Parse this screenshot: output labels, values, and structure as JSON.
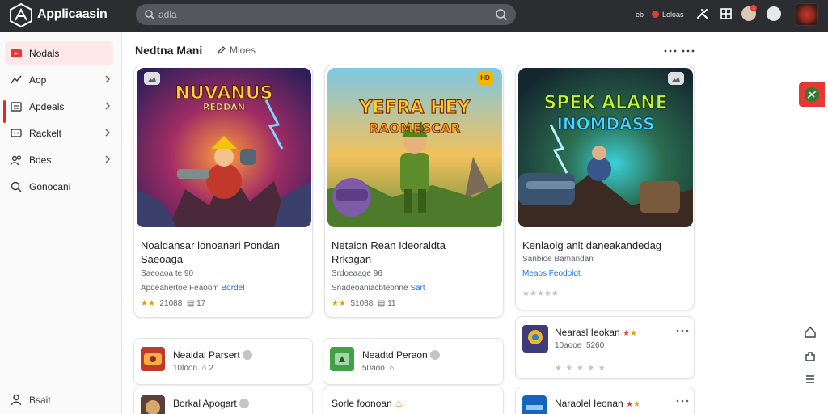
{
  "app": {
    "brand": "Applicaasin"
  },
  "search": {
    "placeholder": "adla"
  },
  "topbar": {
    "label_a": "eb",
    "label_b": "Loloas",
    "notif_count": "1"
  },
  "sidebar": {
    "items": [
      {
        "label": "Nodals",
        "icon": "youtube-icon"
      },
      {
        "label": "Aop",
        "icon": "trend-icon"
      },
      {
        "label": "Apdeals",
        "icon": "list-icon"
      },
      {
        "label": "Rackelt",
        "icon": "chat-icon"
      },
      {
        "label": "Bdes",
        "icon": "people-icon"
      },
      {
        "label": "Gonocani",
        "icon": "search-icon"
      }
    ],
    "bottom_label": "Bsait"
  },
  "section": {
    "title": "Nedtna Mani",
    "link": "Mioes"
  },
  "cards": [
    {
      "art_title": "NUVANUS",
      "art_subtitle": "REDDAN",
      "title_line1": "Noaldansar lonoanari Pondan",
      "title_line2": "Saeoaga",
      "meta": "Saeoaoa te 90",
      "link_prefix": "Apqeahertoe Feaoom",
      "link_text": "Bordel",
      "stats": "21088",
      "stats2": "17",
      "rating": 2
    },
    {
      "art_title": "YEFRA HEY",
      "art_subtitle": "RAOMESCAR",
      "title_line1": "Netaion Rean Ideoraldta",
      "title_line2": "Rrkagan",
      "meta": "Srdoeaage 96",
      "link_prefix": "Snadeoaniacbteonne",
      "link_text": "Sart",
      "stats": "51088",
      "stats2": "11",
      "rating": 2
    },
    {
      "art_title": "SPEK ALANE",
      "art_subtitle": "INOMDASS",
      "title_line1": "Kenlaolg anlt daneakandedag",
      "title_line2": "",
      "meta": "Sanbioe Bamandan",
      "link_prefix": "",
      "link_text": "Meaos Feodoldt",
      "stats": "",
      "stats2": "",
      "rating": 0
    }
  ],
  "small_cards": [
    {
      "title": "Nealdal Parsert",
      "meta": "10loon",
      "meta2": "2"
    },
    {
      "title": "Neadtd Peraon",
      "meta": "50aoo",
      "meta2": ""
    },
    {
      "title": "Nearasl Ieokan",
      "meta": "10aooe",
      "meta2": "5260"
    },
    {
      "title": "Borkal Apogart",
      "meta": "",
      "meta2": ""
    },
    {
      "title": "Sorle foonoan",
      "meta": "",
      "meta2": ""
    },
    {
      "title": "Naraolel Ieonan",
      "meta": "",
      "meta2": ""
    }
  ],
  "colors": {
    "accent": "#d93025",
    "link": "#1a73e8",
    "topbar": "#2b2d31"
  }
}
